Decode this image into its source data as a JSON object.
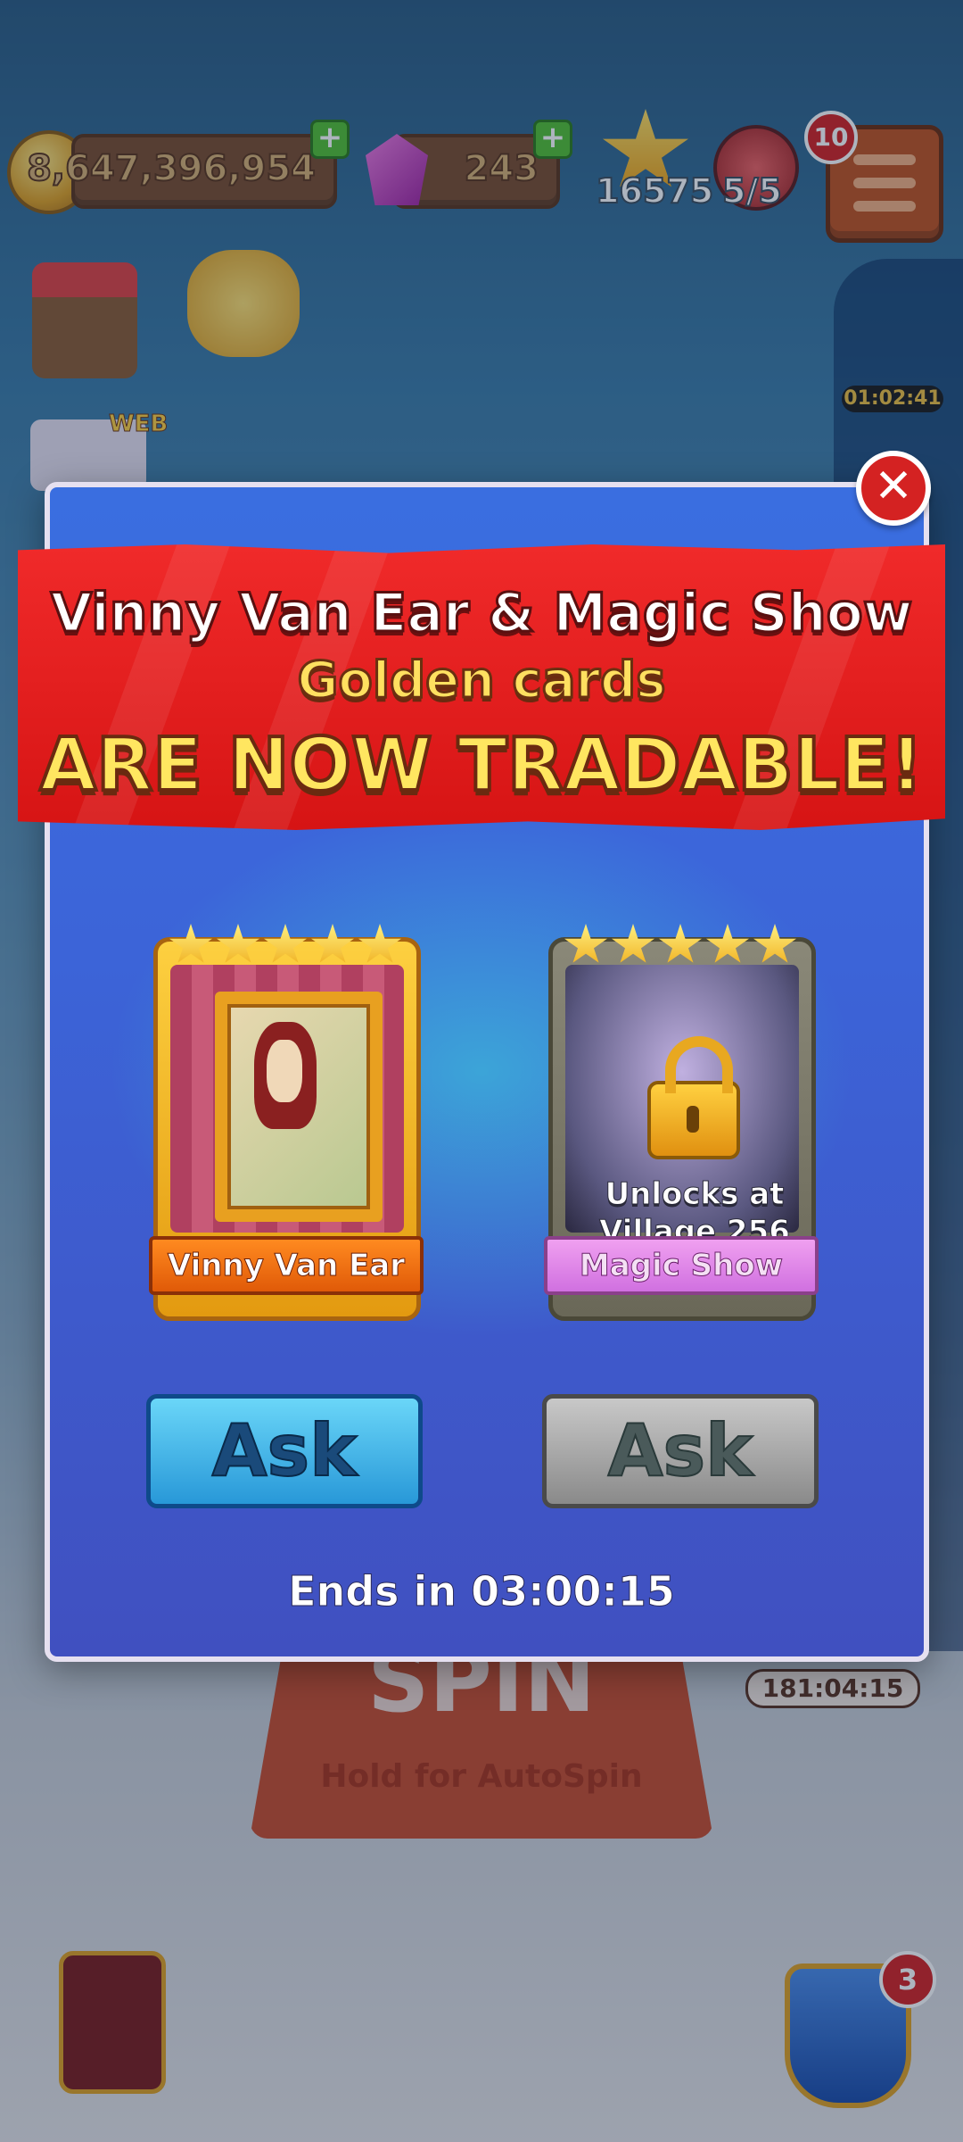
{
  "hud": {
    "coins": "8,647,396,954",
    "gems": "243",
    "stars": "16575",
    "shields": "5/5",
    "menu_badge": "10",
    "plus": "+"
  },
  "side": {
    "event_timer": "01:02:41",
    "bottom_timer": "181:04:15",
    "web_label": "WEB"
  },
  "background": {
    "spin_label": "SPIN",
    "spin_sub": "Hold for AutoSpin",
    "social_badge": "3"
  },
  "modal": {
    "title_line1": "Vinny Van Ear & Magic Show",
    "title_line2": "Golden cards",
    "title_line3": "ARE NOW TRADABLE!",
    "close": "✕",
    "cards": [
      {
        "name": "Vinny Van Ear",
        "stars": 5
      },
      {
        "name": "Magic Show",
        "stars": 5,
        "lock_text_1": "Unlocks at",
        "lock_text_2": "Village 256"
      }
    ],
    "ask_left": "Ask",
    "ask_right": "Ask",
    "ends_in": "Ends in 03:00:15"
  },
  "colors": {
    "banner_red": "#e01c1c",
    "modal_blue": "#3c64d8",
    "ask_blue": "#2898d8",
    "ask_grey": "#8a8a8a"
  }
}
